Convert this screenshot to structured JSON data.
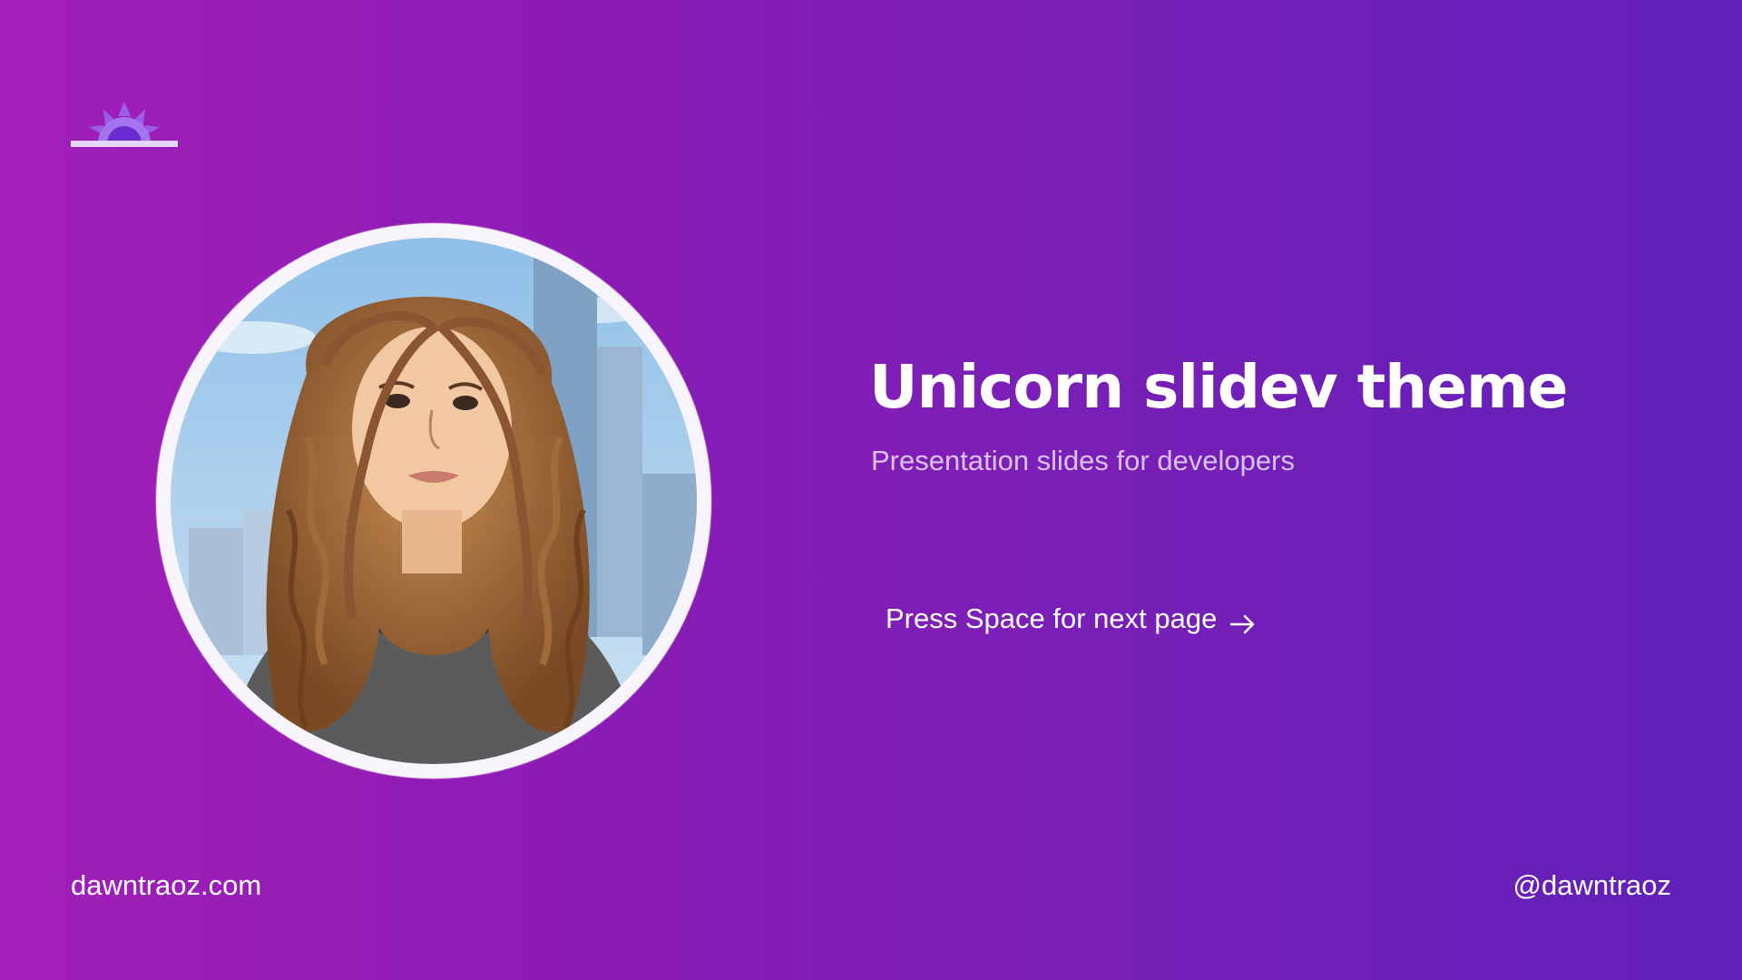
{
  "slide": {
    "title": "Unicorn slidev theme",
    "subtitle": "Presentation slides for developers",
    "next_page_label": "Press Space for next page",
    "next_icon": "arrow-right-icon"
  },
  "footer": {
    "website": "dawntraoz.com",
    "handle": "@dawntraoz"
  },
  "logo": {
    "icon": "sun-logo-icon"
  },
  "avatar": {
    "icon": "avatar-illustration"
  },
  "colors": {
    "background_start": "#a11fb8",
    "background_end": "#5f20b8",
    "text": "#ffffff",
    "subtitle": "#d9c5ee",
    "ring": "#f7f5fb"
  }
}
